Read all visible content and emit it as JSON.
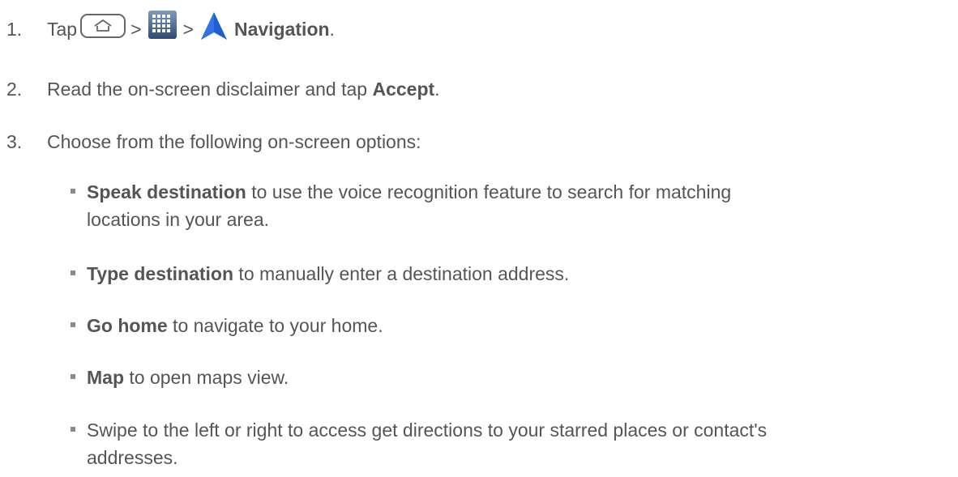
{
  "steps": [
    {
      "number": "1.",
      "prefix": "Tap",
      "separator_1": ">",
      "separator_2": ">",
      "bold": "Navigation",
      "suffix": "."
    },
    {
      "number": "2.",
      "text": "Read the on-screen disclaimer and tap ",
      "bold": "Accept",
      "suffix": "."
    },
    {
      "number": "3.",
      "text": "Choose from the following on-screen options:"
    }
  ],
  "options": [
    {
      "bold": "Speak destination",
      "text_line1": " to use the voice recognition feature to search for matching",
      "text_line2": "locations in your area."
    },
    {
      "bold": "Type destination",
      "text": " to manually enter a destination address."
    },
    {
      "bold": "Go home",
      "text": " to navigate to your home."
    },
    {
      "bold": "Map",
      "text": " to open maps view."
    },
    {
      "text_line1": "Swipe to the left or right to access get directions to your starred places or contact's",
      "text_line2": "addresses."
    }
  ],
  "icons": {
    "home_key": "home-key-icon",
    "apps": "apps-grid-icon",
    "navigation": "navigation-arrow-icon"
  },
  "colors": {
    "text": "#555555",
    "nav_icon": "#1f5fd1",
    "apps_icon": "#4a6f9a"
  }
}
